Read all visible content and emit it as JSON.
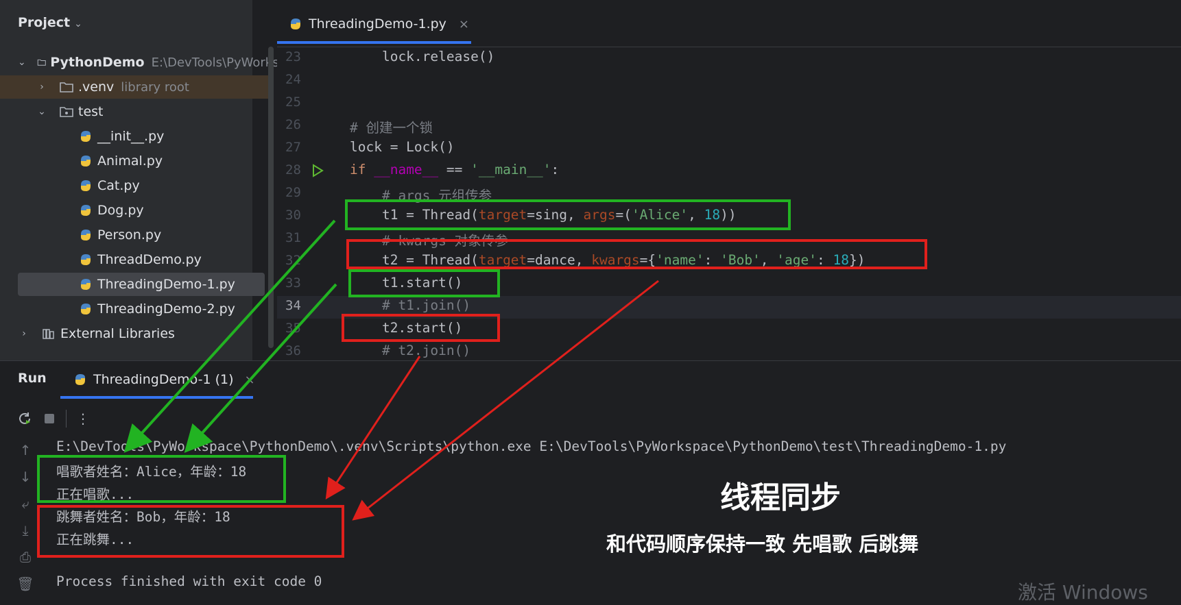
{
  "project_panel": {
    "title": "Project",
    "tree": [
      {
        "label": "PythonDemo",
        "hint": "E:\\DevTools\\PyWorksp",
        "icon": "folder-icon",
        "expanded": true
      },
      {
        "label": ".venv",
        "hint": "library root",
        "icon": "folder-icon",
        "expanded": false
      },
      {
        "label": "test",
        "hint": "",
        "icon": "package-folder-icon",
        "expanded": true
      },
      {
        "label": "__init__.py",
        "icon": "python-file-icon"
      },
      {
        "label": "Animal.py",
        "icon": "python-file-icon"
      },
      {
        "label": "Cat.py",
        "icon": "python-file-icon"
      },
      {
        "label": "Dog.py",
        "icon": "python-file-icon"
      },
      {
        "label": "Person.py",
        "icon": "python-file-icon"
      },
      {
        "label": "ThreadDemo.py",
        "icon": "python-file-icon"
      },
      {
        "label": "ThreadingDemo-1.py",
        "icon": "python-file-icon",
        "selected": true
      },
      {
        "label": "ThreadingDemo-2.py",
        "icon": "python-file-icon"
      },
      {
        "label": "External Libraries",
        "icon": "library-icon",
        "expanded": false
      }
    ]
  },
  "editor": {
    "tab_label": "ThreadingDemo-1.py",
    "close_glyph": "×",
    "gutter": [
      "23",
      "24",
      "25",
      "26",
      "27",
      "28",
      "29",
      "30",
      "31",
      "32",
      "33",
      "34",
      "35",
      "36"
    ],
    "current_line": "34"
  },
  "run_panel": {
    "title": "Run",
    "tab_label": "ThreadingDemo-1 (1)",
    "close_glyph": "×",
    "console": [
      "E:\\DevTools\\PyWorkspace\\PythonDemo\\.venv\\Scripts\\python.exe E:\\DevTools\\PyWorkspace\\PythonDemo\\test\\ThreadingDemo-1.py",
      "唱歌者姓名：Alice，年龄：18",
      "正在唱歌...",
      "跳舞者姓名：Bob，年龄：18",
      "正在跳舞...",
      "",
      "Process finished with exit code 0"
    ]
  },
  "annotation": {
    "title": "线程同步",
    "subtitle": "和代码顺序保持一致  先唱歌 后跳舞",
    "highlight_colors": {
      "green": "#22b322",
      "red": "#e0201c"
    }
  },
  "watermark": "激活 Windows"
}
